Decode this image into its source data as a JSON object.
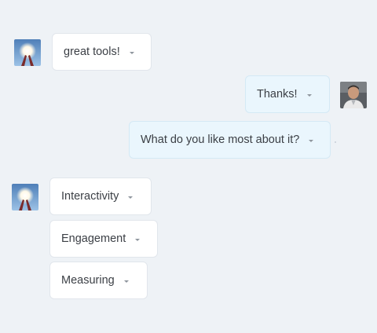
{
  "conversation": {
    "messages": [
      {
        "text": "great tools!",
        "sender": "bot"
      },
      {
        "text": "Thanks!",
        "sender": "user"
      },
      {
        "text": "What do you like most about it?",
        "sender": "user"
      },
      {
        "text": "Interactivity",
        "sender": "bot"
      },
      {
        "text": "Engagement",
        "sender": "bot"
      },
      {
        "text": "Measuring",
        "sender": "bot"
      }
    ]
  },
  "colors": {
    "background": "#eef2f6",
    "bot_bubble": "#ffffff",
    "user_bubble": "#eaf6fd"
  },
  "icons": {
    "bot_avatar": "hands-light-sky-avatar",
    "user_avatar": "person-photo-avatar",
    "menu_caret": "chevron-down-icon"
  }
}
